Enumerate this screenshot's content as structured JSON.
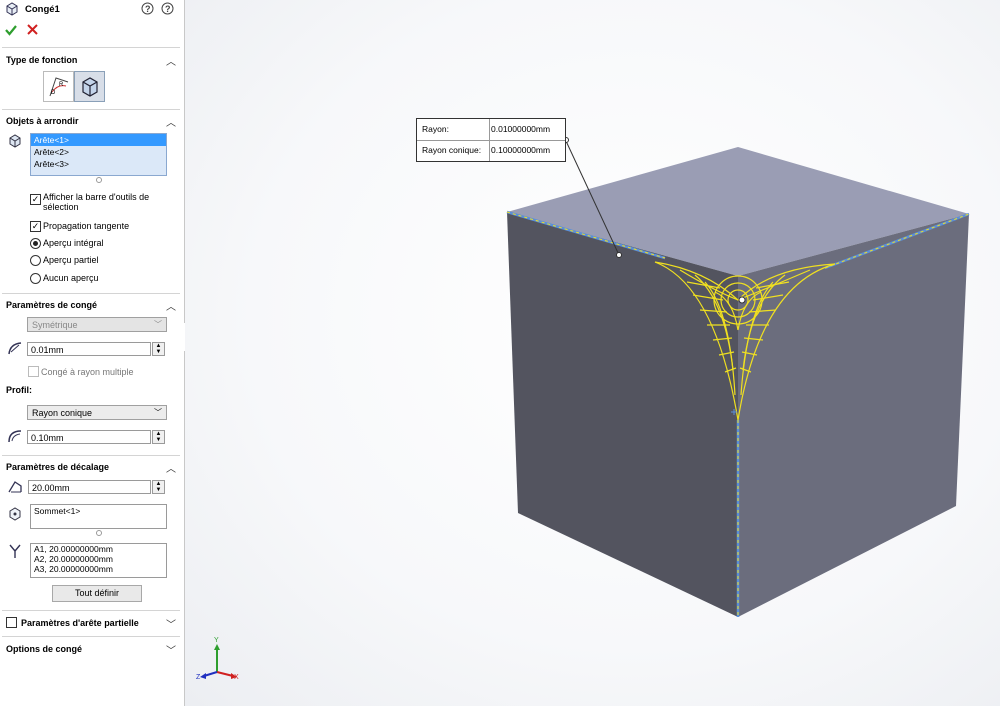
{
  "panel": {
    "title": "Congé1",
    "sections": {
      "feature_type": {
        "title": "Type de fonction"
      },
      "items_to_fillet": {
        "title": "Objets à arrondir",
        "items": [
          "Arête<1>",
          "Arête<2>",
          "Arête<3>"
        ],
        "show_toolbar_label": "Afficher la barre d'outils de sélection",
        "show_toolbar_checked": true,
        "tangent_label": "Propagation tangente",
        "tangent_checked": true,
        "preview_options": [
          "Aperçu intégral",
          "Aperçu partiel",
          "Aucun aperçu"
        ],
        "preview_selected": "Aperçu intégral"
      },
      "fillet_params": {
        "title": "Paramètres de congé",
        "type_value": "Symétrique",
        "radius_value": "0.01mm",
        "multi_radius_label": "Congé à rayon multiple",
        "multi_radius_checked": false,
        "profile_label": "Profil:",
        "profile_value": "Rayon conique",
        "conic_value": "0.10mm"
      },
      "setback_params": {
        "title": "Paramètres de décalage",
        "distance_value": "20.00mm",
        "vertex_items": [
          "Sommet<1>"
        ],
        "setback_items": [
          "A1, 20.00000000mm",
          "A2, 20.00000000mm",
          "A3, 20.00000000mm"
        ],
        "set_all_label": "Tout définir"
      },
      "partial_edge": {
        "title": "Paramètres d'arête partielle",
        "checked": false
      },
      "fillet_options": {
        "title": "Options de congé"
      }
    }
  },
  "callout": {
    "radius_label": "Rayon:",
    "radius_value": "0.01000000mm",
    "conic_label": "Rayon conique:",
    "conic_value": "0.10000000mm"
  },
  "triad": {
    "x": "X",
    "y": "Y",
    "z": "Z"
  },
  "colors": {
    "accept": "#2e9e2e",
    "cancel": "#d02020",
    "selection": "#3399ff",
    "fillet_preview": "#f0e020",
    "edge_highlight": "#5b8fd8"
  }
}
